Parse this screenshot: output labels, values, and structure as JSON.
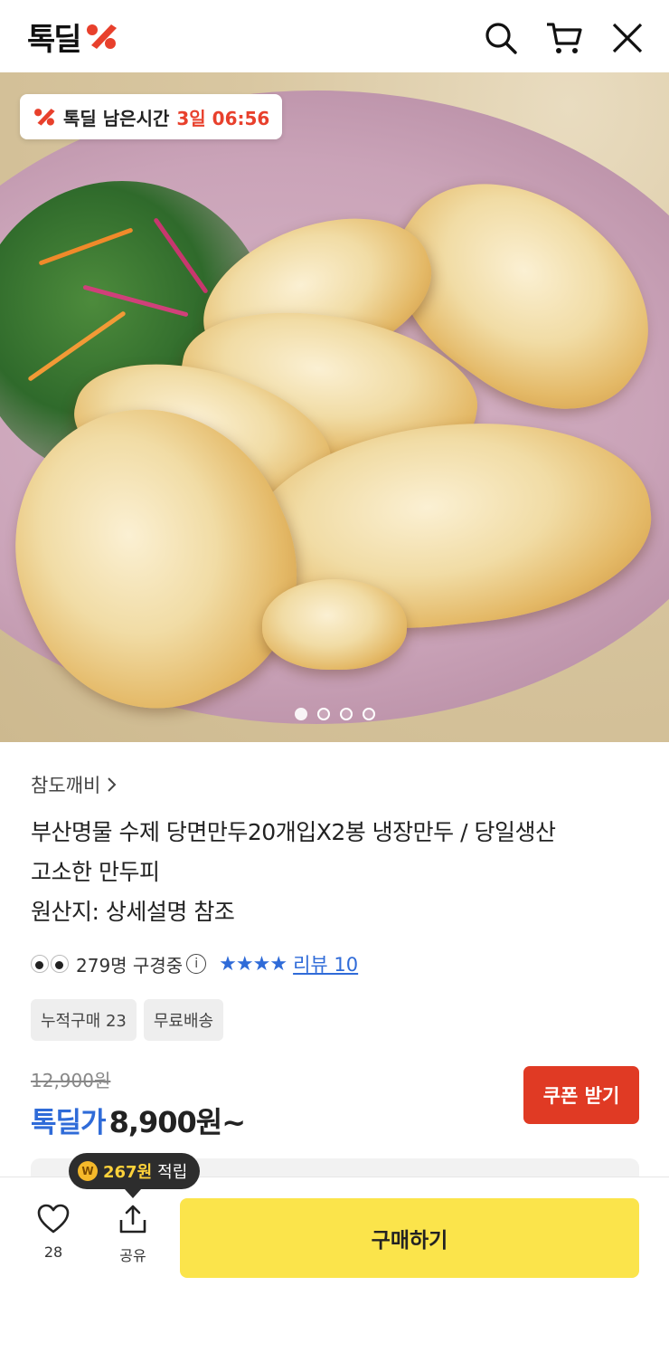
{
  "header": {
    "logo_text": "톡딜",
    "icons": [
      "search-icon",
      "cart-icon",
      "close-icon"
    ]
  },
  "hero": {
    "timer_label": "톡딜 남은시간",
    "timer_value": "3일 06:56",
    "carousel_total": 4,
    "carousel_active": 1
  },
  "product": {
    "store": "참도깨비",
    "title_lines": [
      "부산명물 수제 당면만두20개입X2봉 냉장만두 / 당일생산",
      "고소한 만두피",
      "원산지: 상세설명 참조"
    ],
    "viewers": "279명 구경중",
    "rating_stars": 4,
    "review_link": "리뷰 10",
    "tags": [
      "누적구매 23",
      "무료배송"
    ],
    "original_price": "12,900원",
    "sale_label": "톡딜가",
    "sale_price": "8,900원~",
    "coupon_button": "쿠폰 받기"
  },
  "bottom_bar": {
    "points_amount": "267원",
    "points_suffix": "적립",
    "like_count": "28",
    "share_label": "공유",
    "buy_label": "구매하기"
  },
  "colors": {
    "accent_blue": "#2f6bd8",
    "coupon_red": "#e03a24",
    "buy_yellow": "#fbe44b",
    "timer_red": "#e8402c"
  }
}
